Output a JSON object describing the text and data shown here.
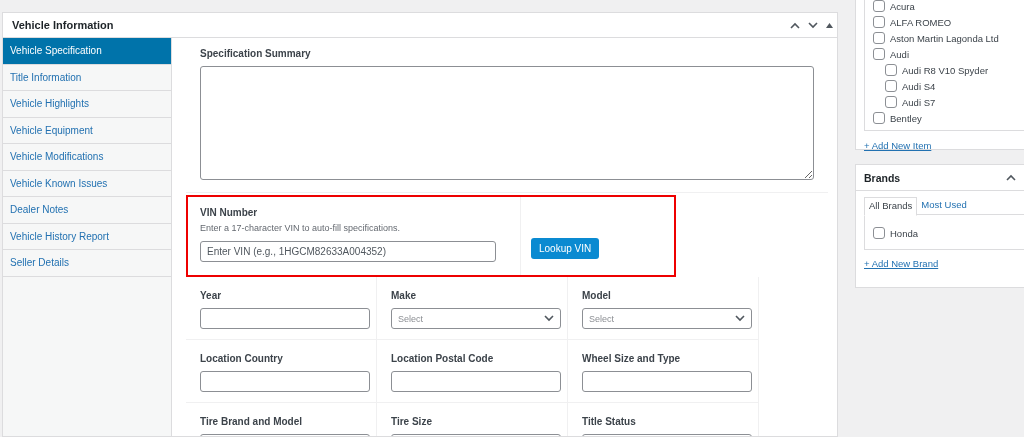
{
  "main_panel": {
    "title": "Vehicle Information",
    "tabs": [
      {
        "label": "Vehicle Specification",
        "selected": true
      },
      {
        "label": "Title Information",
        "selected": false
      },
      {
        "label": "Vehicle Highlights",
        "selected": false
      },
      {
        "label": "Vehicle Equipment",
        "selected": false
      },
      {
        "label": "Vehicle Modifications",
        "selected": false
      },
      {
        "label": "Vehicle Known Issues",
        "selected": false
      },
      {
        "label": "Dealer Notes",
        "selected": false
      },
      {
        "label": "Vehicle History Report",
        "selected": false
      },
      {
        "label": "Seller Details",
        "selected": false
      }
    ],
    "specification_summary": {
      "label": "Specification Summary"
    },
    "vin": {
      "label": "VIN Number",
      "description": "Enter a 17-character VIN to auto-fill specifications.",
      "placeholder": "Enter VIN (e.g., 1HGCM82633A004352)",
      "button": "Lookup VIN",
      "highlighted": true
    },
    "fields": [
      {
        "label": "Year",
        "kind": "text"
      },
      {
        "label": "Make",
        "kind": "select",
        "placeholder": "Select"
      },
      {
        "label": "Model",
        "kind": "select",
        "placeholder": "Select"
      },
      {
        "label": "Location Country",
        "kind": "text"
      },
      {
        "label": "Location Postal Code",
        "kind": "text"
      },
      {
        "label": "Wheel Size and Type",
        "kind": "text"
      },
      {
        "label": "Tire Brand and Model",
        "kind": "text"
      },
      {
        "label": "Tire Size",
        "kind": "text"
      },
      {
        "label": "Title Status",
        "kind": "text"
      }
    ]
  },
  "item_checklist": {
    "items": [
      {
        "label": "Acura",
        "checked": false
      },
      {
        "label": "ALFA ROMEO",
        "checked": false
      },
      {
        "label": "Aston Martin Lagonda Ltd",
        "checked": false
      },
      {
        "label": "Audi",
        "checked": false,
        "children": [
          {
            "label": "Audi R8 V10 Spyder",
            "checked": false
          },
          {
            "label": "Audi S4",
            "checked": false
          },
          {
            "label": "Audi S7",
            "checked": false
          }
        ]
      },
      {
        "label": "Bentley",
        "checked": false
      }
    ],
    "add_link": "+ Add New Item"
  },
  "brands": {
    "title": "Brands",
    "tabs": [
      {
        "label": "All Brands",
        "selected": true
      },
      {
        "label": "Most Used",
        "selected": false
      }
    ],
    "items": [
      {
        "label": "Honda",
        "checked": false
      }
    ],
    "add_link": "+ Add New Brand"
  }
}
